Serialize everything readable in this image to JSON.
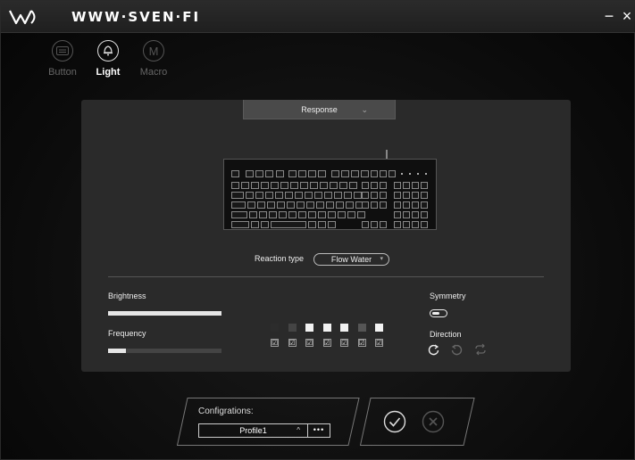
{
  "app": {
    "brand": "WWW·SVEN·FI",
    "minimize": "−",
    "close": "×"
  },
  "modes": [
    {
      "label": "Button",
      "active": false,
      "icon": "keyboard-icon"
    },
    {
      "label": "Light",
      "active": true,
      "icon": "bulb-icon"
    },
    {
      "label": "Macro",
      "active": false,
      "icon": "macro-icon",
      "glyph": "M"
    }
  ],
  "effect": {
    "selected": "Response"
  },
  "reaction": {
    "label": "Reaction type",
    "selected": "Flow Water"
  },
  "brightness": {
    "label": "Brightness",
    "value": 1.0
  },
  "frequency": {
    "label": "Frequency",
    "value": 0.16
  },
  "colors": [
    "#2c2c2c",
    "#444444",
    "#f2f2f2",
    "#f2f2f2",
    "#f2f2f2",
    "#555555",
    "#f2f2f2"
  ],
  "checks": [
    "☑",
    "☑",
    "☑",
    "☑",
    "☑",
    "☑",
    "☑"
  ],
  "symmetry": {
    "label": "Symmetry",
    "on": false
  },
  "direction": {
    "label": "Direction",
    "options": [
      "rotate-cw-icon",
      "rotate-ccw-icon",
      "repeat-icon"
    ]
  },
  "config": {
    "label": "Configrations:",
    "profile": "Profile1",
    "more": "•••"
  },
  "actions": {
    "confirm": "check-icon",
    "cancel": "cancel-icon"
  }
}
